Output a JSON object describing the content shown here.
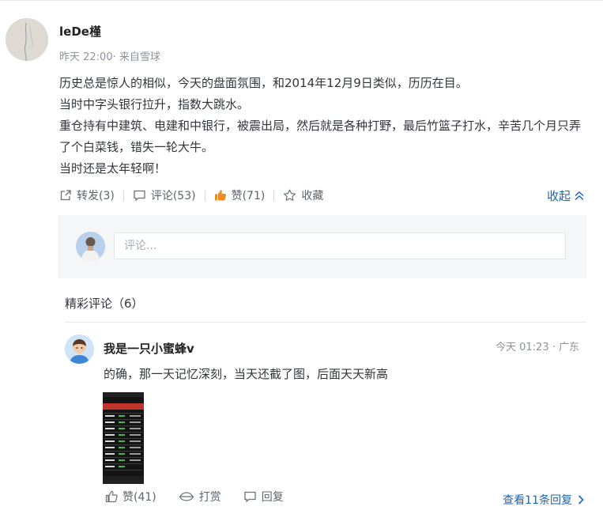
{
  "post": {
    "author": "leDe槿",
    "meta": "昨天 22:00· 来自雪球",
    "lines": [
      "历史总是惊人的相似，今天的盘面氛围，和2014年12月9日类似，历历在目。",
      "当时中字头银行拉升，指数大跳水。",
      "重仓持有中建筑、电建和中银行，被震出局，然后就是各种打野，最后竹篮子打水，辛苦几个月只弄了个白菜钱，错失一轮大牛。",
      "当时还是太年轻啊！"
    ],
    "actions": {
      "repost": "转发(3)",
      "comment": "评论(53)",
      "like": "赞(71)",
      "favorite": "收藏"
    },
    "collapse": "收起"
  },
  "reply_box": {
    "placeholder": "评论..."
  },
  "comments_section": {
    "title": "精彩评论（6）",
    "comment": {
      "name": "我是一只小蜜蜂v",
      "time": "今天 01:23 · 广东",
      "text": "的确，那一天记忆深刻，当天还截了图，后面天天新高",
      "like": "赞(41)",
      "tip": "打赏",
      "reply": "回复",
      "more_replies": "查看11条回复"
    }
  },
  "colors": {
    "link": "#1a66b8",
    "like_icon": "#f08a24",
    "text": "#33353c",
    "muted": "#8f939b"
  },
  "icons": [
    "repost-icon",
    "comment-icon",
    "like-icon",
    "star-icon",
    "chevron-up-icon",
    "tip-icon",
    "reply-icon",
    "chevron-right-icon"
  ]
}
